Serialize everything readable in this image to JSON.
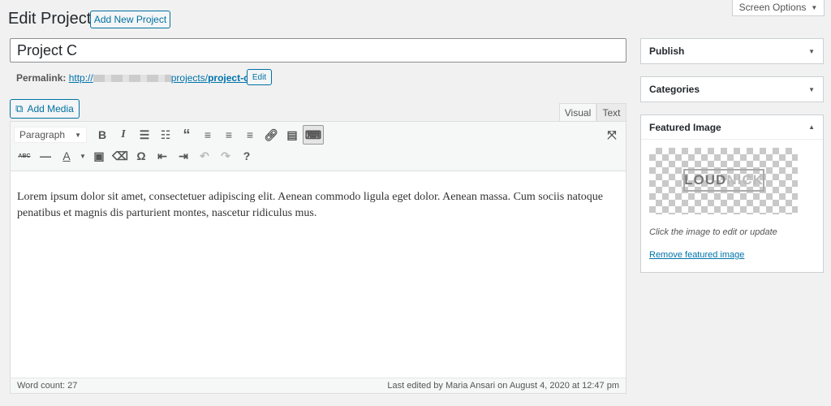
{
  "header": {
    "title": "Edit Project",
    "add_new": "Add New Project",
    "screen_options": "Screen Options"
  },
  "post": {
    "title": "Project C",
    "permalink_label": "Permalink:",
    "permalink_prefix": "http://",
    "permalink_path": "projects/",
    "permalink_slug": "project-c",
    "permalink_suffix": "/",
    "edit_label": "Edit"
  },
  "editor": {
    "add_media": "Add Media",
    "tabs": [
      "Visual",
      "Text"
    ],
    "format_select": "Paragraph",
    "toolbar_row1": [
      "bold-icon",
      "italic-icon",
      "bulleted-list-icon",
      "numbered-list-icon",
      "blockquote-icon",
      "align-left-icon",
      "align-center-icon",
      "align-right-icon",
      "link-icon",
      "read-more-icon",
      "toolbar-toggle-icon"
    ],
    "toolbar_row2": [
      "strikethrough-icon",
      "horizontal-line-icon",
      "text-color-icon",
      "paste-as-text-icon",
      "clear-formatting-icon",
      "special-character-icon",
      "decrease-indent-icon",
      "increase-indent-icon",
      "undo-icon",
      "redo-icon",
      "help-icon"
    ],
    "content": "Lorem ipsum dolor sit amet, consectetuer adipiscing elit. Aenean commodo ligula eget dolor. Aenean massa. Cum sociis natoque penatibus et magnis dis parturient montes, nascetur ridiculus mus.",
    "word_count": "Word count: 27",
    "last_edited": "Last edited by Maria Ansari on August 4, 2020 at 12:47 pm"
  },
  "sidebar": {
    "publish": "Publish",
    "categories": "Categories",
    "featured_image": "Featured Image",
    "logo_text_a": "LOUD",
    "logo_text_b": "NICK",
    "hint": "Click the image to edit or update",
    "remove": "Remove featured image"
  }
}
